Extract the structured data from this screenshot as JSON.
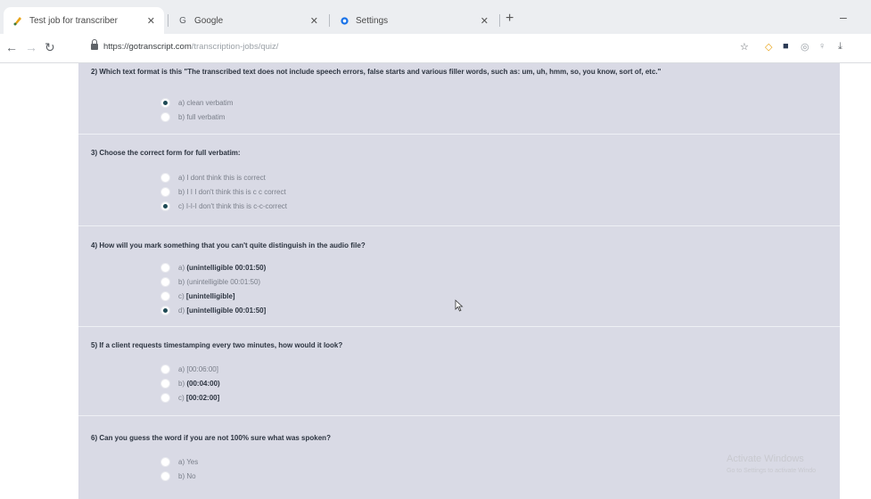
{
  "browser": {
    "tabs": [
      {
        "title": "Test job for transcriber",
        "icon": "transcriber-favicon"
      },
      {
        "title": "Google",
        "icon": "google-favicon"
      },
      {
        "title": "Settings",
        "icon": "gear-icon"
      }
    ],
    "url_host": "https://gotranscript.com",
    "url_path": "/transcription-jobs/quiz/"
  },
  "quiz": {
    "q2": {
      "text": "2) Which text format is this \"The transcribed text does not include speech errors, false starts and various filler words, such as: um, uh, hmm, so, you know, sort of, etc.\"",
      "options": [
        "a) clean verbatim",
        "b) full verbatim"
      ]
    },
    "q3": {
      "text": "3) Choose the correct form for full verbatim:",
      "options": [
        "a) I dont think this is correct",
        "b) I I I don't think this is c c correct",
        "c) I-I-I don't think this is c-c-correct"
      ]
    },
    "q4": {
      "text": "4) How will you mark something that you can't quite distinguish in the audio file?",
      "options": [
        {
          "prefix": "a)",
          "value": "(unintelligible 00:01:50)"
        },
        {
          "prefix": "b)",
          "value": "(unintelligible 00:01:50)"
        },
        {
          "prefix": "c)",
          "value": "[unintelligible]"
        },
        {
          "prefix": "d)",
          "value": "[unintelligible 00:01:50]"
        }
      ]
    },
    "q5": {
      "text": "5) If a client requests timestamping every two minutes, how would it look?",
      "options": [
        {
          "prefix": "a)",
          "value": "[00:06:00]"
        },
        {
          "prefix": "b)",
          "value": "(00:04:00)"
        },
        {
          "prefix": "c)",
          "value": "[00:02:00]"
        }
      ]
    },
    "q6": {
      "text": "6) Can you guess the word if you are not 100% sure what was spoken?",
      "options": [
        "a) Yes",
        "b) No"
      ]
    }
  },
  "watermark": {
    "title": "Activate Windows",
    "sub": "Go to Settings to activate Windo"
  }
}
